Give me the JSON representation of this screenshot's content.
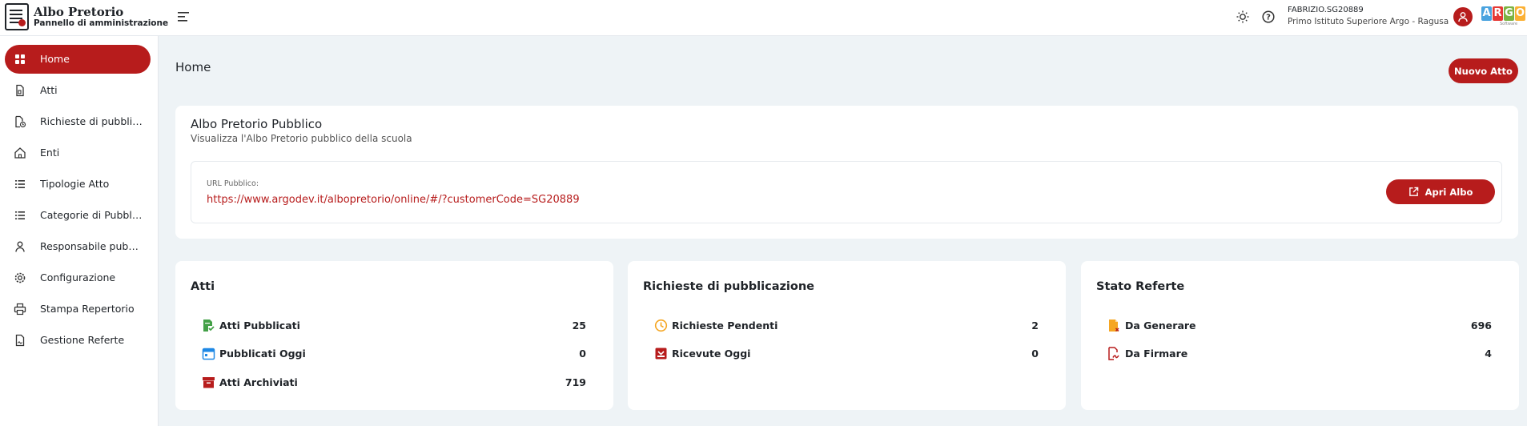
{
  "header": {
    "app_title": "Albo Pretorio",
    "app_subtitle": "Pannello di amministrazione",
    "user_code": "FABRIZIO.SG20889",
    "school_name": "Primo Istituto Superiore Argo - Ragusa",
    "brand_letters": [
      "A",
      "R",
      "G",
      "O"
    ],
    "brand_sub": "Software"
  },
  "sidebar": {
    "items": [
      {
        "label": "Home",
        "icon": "dashboard-icon",
        "active": true
      },
      {
        "label": "Atti",
        "icon": "document-icon"
      },
      {
        "label": "Richieste di pubblicazione",
        "icon": "document-clock-icon"
      },
      {
        "label": "Enti",
        "icon": "home-icon"
      },
      {
        "label": "Tipologie Atto",
        "icon": "list-icon"
      },
      {
        "label": "Categorie di Pubblicazione",
        "icon": "list-icon"
      },
      {
        "label": "Responsabile pubblicazione",
        "icon": "person-icon"
      },
      {
        "label": "Configurazione",
        "icon": "gear-icon"
      },
      {
        "label": "Stampa Repertorio",
        "icon": "printer-icon"
      },
      {
        "label": "Gestione Referte",
        "icon": "document-signed-icon"
      }
    ]
  },
  "main": {
    "page_title": "Home",
    "new_button_label": "Nuovo Atto",
    "albo_card": {
      "title": "Albo Pretorio Pubblico",
      "subtitle": "Visualizza l'Albo Pretorio pubblico della scuola",
      "url_label": "URL Pubblico:",
      "url_value": "https://www.argodev.it/albopretorio/online/#/?customerCode=SG20889",
      "open_button_label": "Apri Albo"
    },
    "stats": [
      {
        "title": "Atti",
        "rows": [
          {
            "label": "Atti Pubblicati",
            "value": "25",
            "icon": "document-check-icon",
            "color": "#43a047"
          },
          {
            "label": "Pubblicati Oggi",
            "value": "0",
            "icon": "calendar-icon",
            "color": "#1e88e5"
          },
          {
            "label": "Atti Archiviati",
            "value": "719",
            "icon": "archive-icon",
            "color": "#b71c1c"
          }
        ]
      },
      {
        "title": "Richieste di pubblicazione",
        "rows": [
          {
            "label": "Richieste Pendenti",
            "value": "2",
            "icon": "clock-icon",
            "color": "#f5a623"
          },
          {
            "label": "Ricevute Oggi",
            "value": "0",
            "icon": "inbox-icon",
            "color": "#b71c1c"
          }
        ]
      },
      {
        "title": "Stato Referte",
        "rows": [
          {
            "label": "Da Generare",
            "value": "696",
            "icon": "document-pending-icon",
            "color": "#f5a623"
          },
          {
            "label": "Da Firmare",
            "value": "4",
            "icon": "signature-icon",
            "color": "#b71c1c"
          }
        ]
      }
    ]
  },
  "colors": {
    "accent": "#b71c1c",
    "background": "#eef3f6"
  }
}
